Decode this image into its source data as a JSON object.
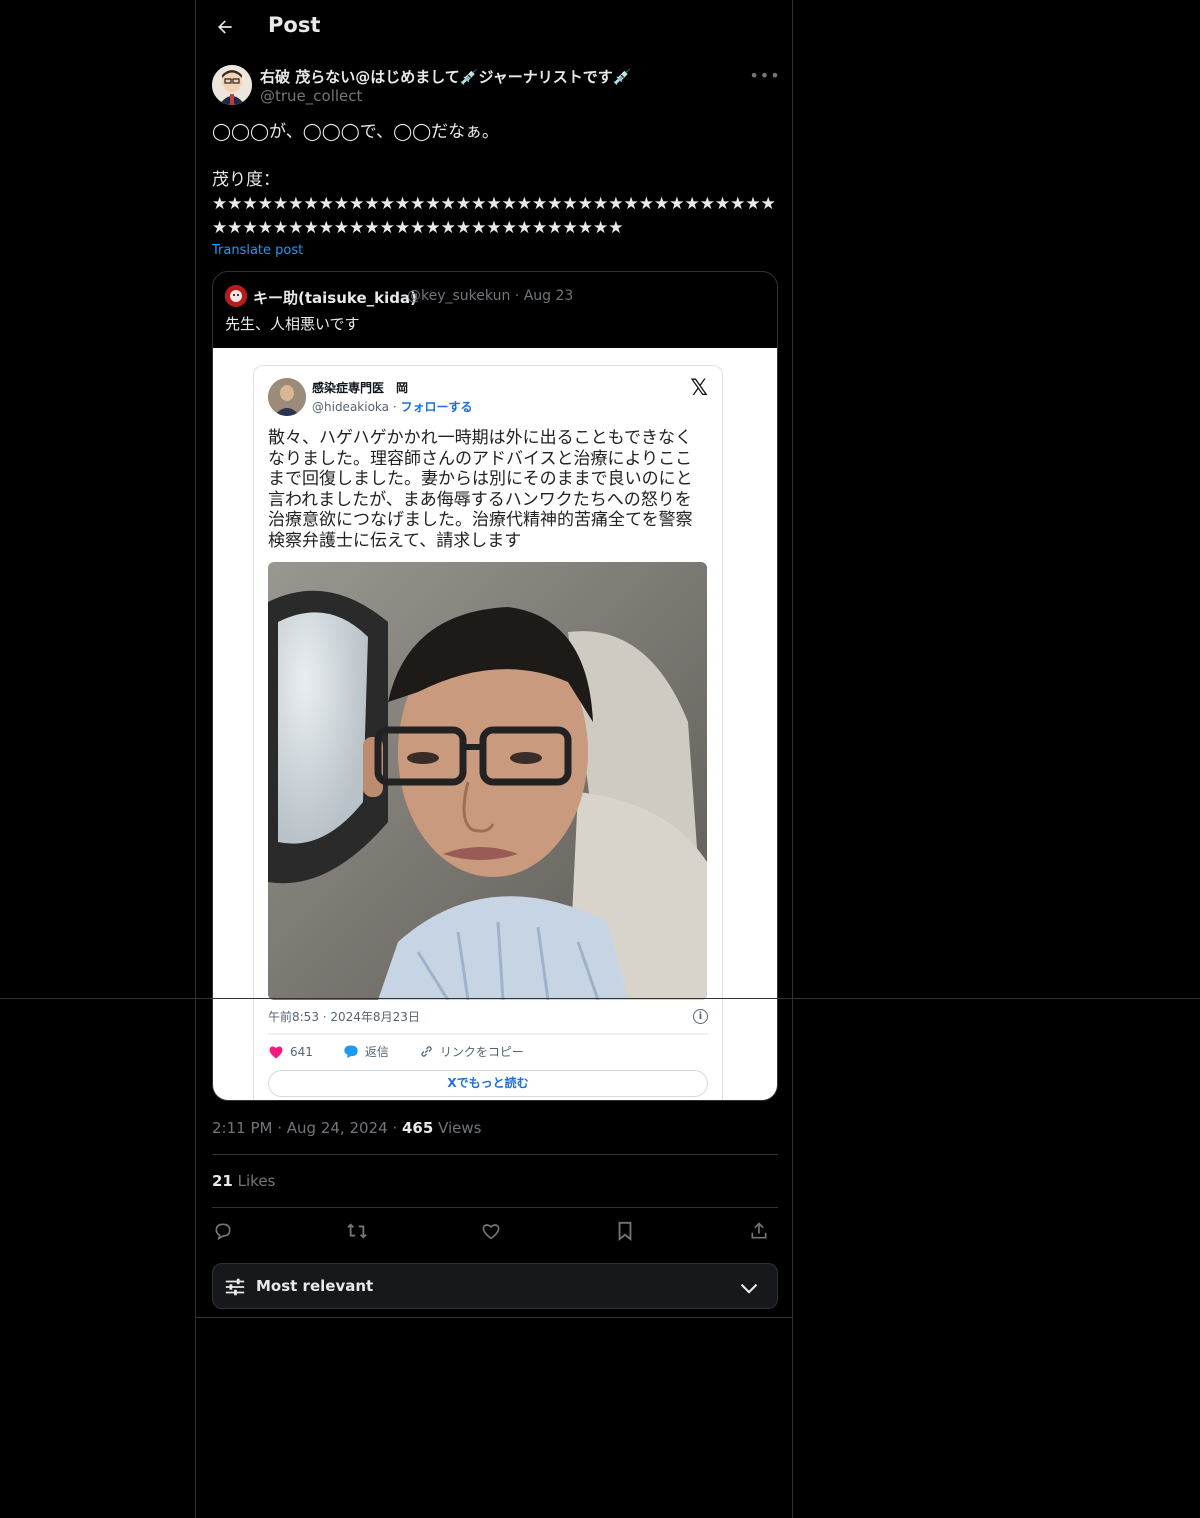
{
  "header": {
    "title": "Post"
  },
  "post": {
    "display_name": "右破 茂らない@はじめまして💉ジャーナリストです💉",
    "handle": "@true_collect",
    "text": "◯◯◯が、◯◯◯で、◯◯だなぁ。\n\n茂り度：\n★★★★★★★★★★★★★★★★★★★★★★★★★★★★★★★★★★★★★★★★★★★★★★★★★★★★★★★★★★★★★★★★",
    "translate_label": "Translate post",
    "time": "2:11 PM",
    "date": "Aug 24, 2024",
    "views_count": "465",
    "views_label": "Views",
    "likes_count": "21",
    "likes_label": "Likes"
  },
  "quote": {
    "name": "キー助(taisuke_kida)",
    "handle": "@key_sukekun",
    "date": "Aug 23",
    "text": "先生、人相悪いです",
    "embed": {
      "name": "感染症専門医　岡",
      "handle": "@hideakioka",
      "follow": "フォローする",
      "text": "散々、ハゲハゲかかれ一時期は外に出ることもできなくなりました。理容師さんのアドバイスと治療によりここまで回復しました。妻からは別にそのままで良いのにと言われましたが、まあ侮辱するハンワクたちへの怒りを治療意欲につなげました。治療代精神的苦痛全てを警察検察弁護士に伝えて、請求します",
      "timestamp": "午前8:53 · 2024年8月23日",
      "likes": "641",
      "reply": "返信",
      "copy_link": "リンクをコピー",
      "read_more": "Xでもっと読む"
    }
  },
  "sort": {
    "label": "Most relevant"
  },
  "colors": {
    "accent": "#1d9bf0",
    "bg": "#000000",
    "muted": "#71767b",
    "border": "#2f3336"
  }
}
